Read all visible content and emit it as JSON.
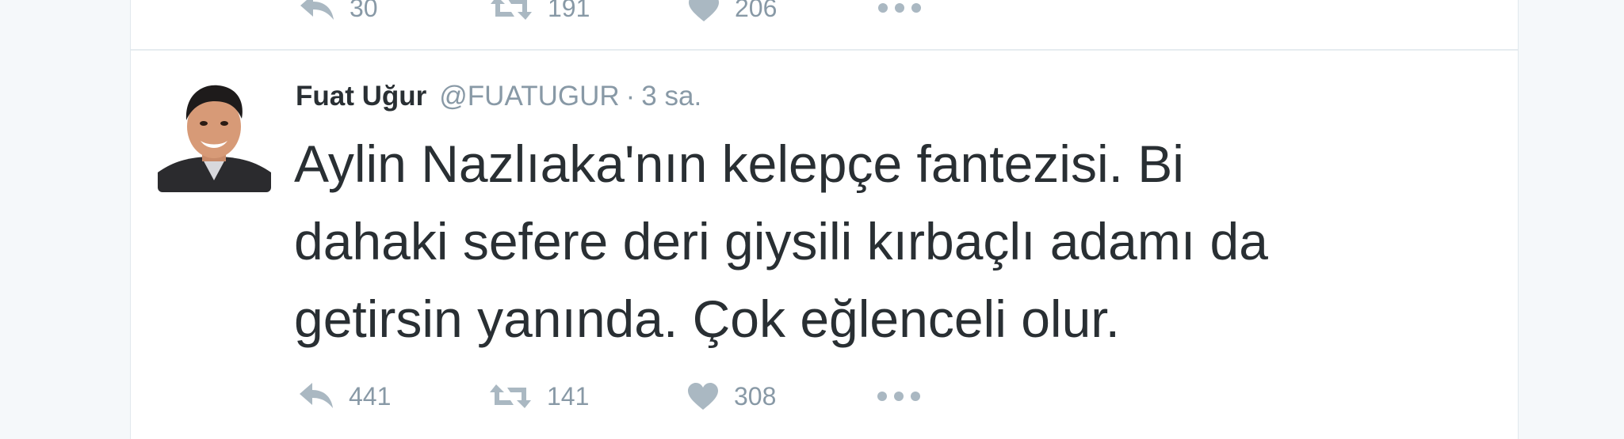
{
  "previous_tweet": {
    "stats": {
      "replies": "30",
      "retweets": "191",
      "likes": "206"
    }
  },
  "tweet": {
    "author": {
      "name": "Fuat Uğur",
      "handle": "@FUATUGUR"
    },
    "separator": "·",
    "timestamp": "3 sa.",
    "text_lines": [
      "Aylin Nazlıaka'nın kelepçe fantezisi. Bi",
      "dahaki sefere deri giysili kırbaçlı adamı da",
      "getirsin yanında. Çok eğlenceli olur."
    ],
    "stats": {
      "replies": "441",
      "retweets": "141",
      "likes": "308"
    }
  },
  "icons": {
    "reply": "reply-icon",
    "retweet": "retweet-icon",
    "like": "heart-icon",
    "more": "more-icon"
  },
  "colors": {
    "background": "#f5f8fa",
    "card": "#ffffff",
    "text": "#292f33",
    "muted": "#8899a6",
    "icon": "#aab8c2"
  }
}
